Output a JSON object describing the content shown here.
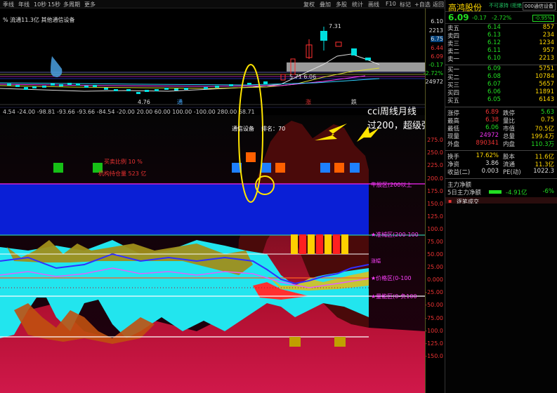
{
  "toolbar": {
    "left_items": [
      "季线",
      "年线",
      "10秒",
      "15秒",
      "多周期",
      "更多"
    ],
    "right_items": [
      "复权",
      "叠加",
      "多股",
      "统计",
      "画线",
      "F10",
      "标记",
      "+自选",
      "返回"
    ],
    "close": "✕"
  },
  "chart": {
    "info_line": "% 流通11.3亿 其他通信设备",
    "ma_label": "5.71  6.06",
    "high_label": "7.31",
    "low_label": "4.76",
    "vol_top_label": "24972",
    "cci_values_text": "4.54   -24.00   -98.81   -93.66   -93.66   -84.54   -20.00   20.00   60.00   100.00   -100.00   280.00   68.71",
    "mid_markers": [
      "通",
      "涨",
      "跌"
    ],
    "sector_label": "通信设备",
    "rank_label": "排名：70",
    "annot_red1": "买卖比例 10 %",
    "annot_red2": "机构持仓量 523 亿",
    "annot_line1": "cci周线月线",
    "annot_line2": "过200，超级强势",
    "zone_labels": [
      "牛股区(200以上",
      "★准械区(200-100",
      "★价格区(0-100",
      "★量能区(0-负100"
    ],
    "zone_label_tiny": "涨幅"
  },
  "axis": {
    "top": [
      "6.10",
      "2213",
      "6.75",
      "6.44",
      "6.09",
      "-0.17",
      "-2.72%",
      "24972"
    ],
    "bottom": [
      "275.0",
      "250.0",
      "225.0",
      "200.0",
      "175.0",
      "150.0",
      "125.0",
      "100.0",
      "75.00",
      "50.00",
      "25.00",
      "0.000",
      "-25.00",
      "-50.00",
      "-75.00",
      "-100.0",
      "-125.0",
      "-150.0"
    ]
  },
  "panel": {
    "title": "高鸿股份",
    "subtitle": "不可滚持 (拒绝)",
    "settings_btn": "000通信设备",
    "price": "6.09",
    "change": "-0.17",
    "change_pct": "-2.72%",
    "badge": "-0.95%",
    "asks": [
      {
        "label": "卖五",
        "price": "6.14",
        "vol": "857"
      },
      {
        "label": "卖四",
        "price": "6.13",
        "vol": "234"
      },
      {
        "label": "卖三",
        "price": "6.12",
        "vol": "1234"
      },
      {
        "label": "卖二",
        "price": "6.11",
        "vol": "957"
      },
      {
        "label": "卖一",
        "price": "6.10",
        "vol": "2213"
      }
    ],
    "bids": [
      {
        "label": "买一",
        "price": "6.09",
        "vol": "5751"
      },
      {
        "label": "买二",
        "price": "6.08",
        "vol": "10784"
      },
      {
        "label": "买三",
        "price": "6.07",
        "vol": "5657"
      },
      {
        "label": "买四",
        "price": "6.06",
        "vol": "11891"
      },
      {
        "label": "买五",
        "price": "6.05",
        "vol": "6143"
      }
    ],
    "stats": [
      [
        {
          "k": "涨停",
          "v": "6.89",
          "c": "red"
        },
        {
          "k": "跌停",
          "v": "5.63",
          "c": "grn"
        }
      ],
      [
        {
          "k": "最高",
          "v": "6.38",
          "c": "red"
        },
        {
          "k": "量比",
          "v": "0.75",
          "c": "yel"
        }
      ],
      [
        {
          "k": "最低",
          "v": "6.06",
          "c": "grn"
        },
        {
          "k": "市值",
          "v": "70.5亿",
          "c": "yel"
        }
      ],
      [
        {
          "k": "现量",
          "v": "24972",
          "c": "mag"
        },
        {
          "k": "总量",
          "v": "199.4万",
          "c": "yel"
        }
      ],
      [
        {
          "k": "外盘",
          "v": "890341",
          "c": "red"
        },
        {
          "k": "内盘",
          "v": "110.3万",
          "c": "grn"
        }
      ]
    ],
    "stats2": [
      [
        {
          "k": "换手",
          "v": "17.62%",
          "c": "yel"
        },
        {
          "k": "股本",
          "v": "11.6亿",
          "c": "yel"
        }
      ],
      [
        {
          "k": "净资",
          "v": "3.86",
          "c": "wht"
        },
        {
          "k": "流通",
          "v": "11.3亿",
          "c": "yel"
        }
      ],
      [
        {
          "k": "收益(二)",
          "v": "0.003",
          "c": "wht"
        },
        {
          "k": "PE(动)",
          "v": "1022.3",
          "c": "wht"
        }
      ]
    ],
    "mainflow_title": "主力净额",
    "mainflow_label": "5日主力净额",
    "mainflow_value": "-4.91亿",
    "mainflow_pct": "-6%",
    "strip_text": "逐笔成交"
  },
  "colors": {
    "bg": "#000000",
    "up": "#e33333",
    "down": "#22dd22",
    "bull_zone": "#0a1fd6",
    "cyan": "#22e5ee",
    "olive": "#b09a1a",
    "crimson": "#c0103a",
    "yellow": "#ffd700"
  }
}
